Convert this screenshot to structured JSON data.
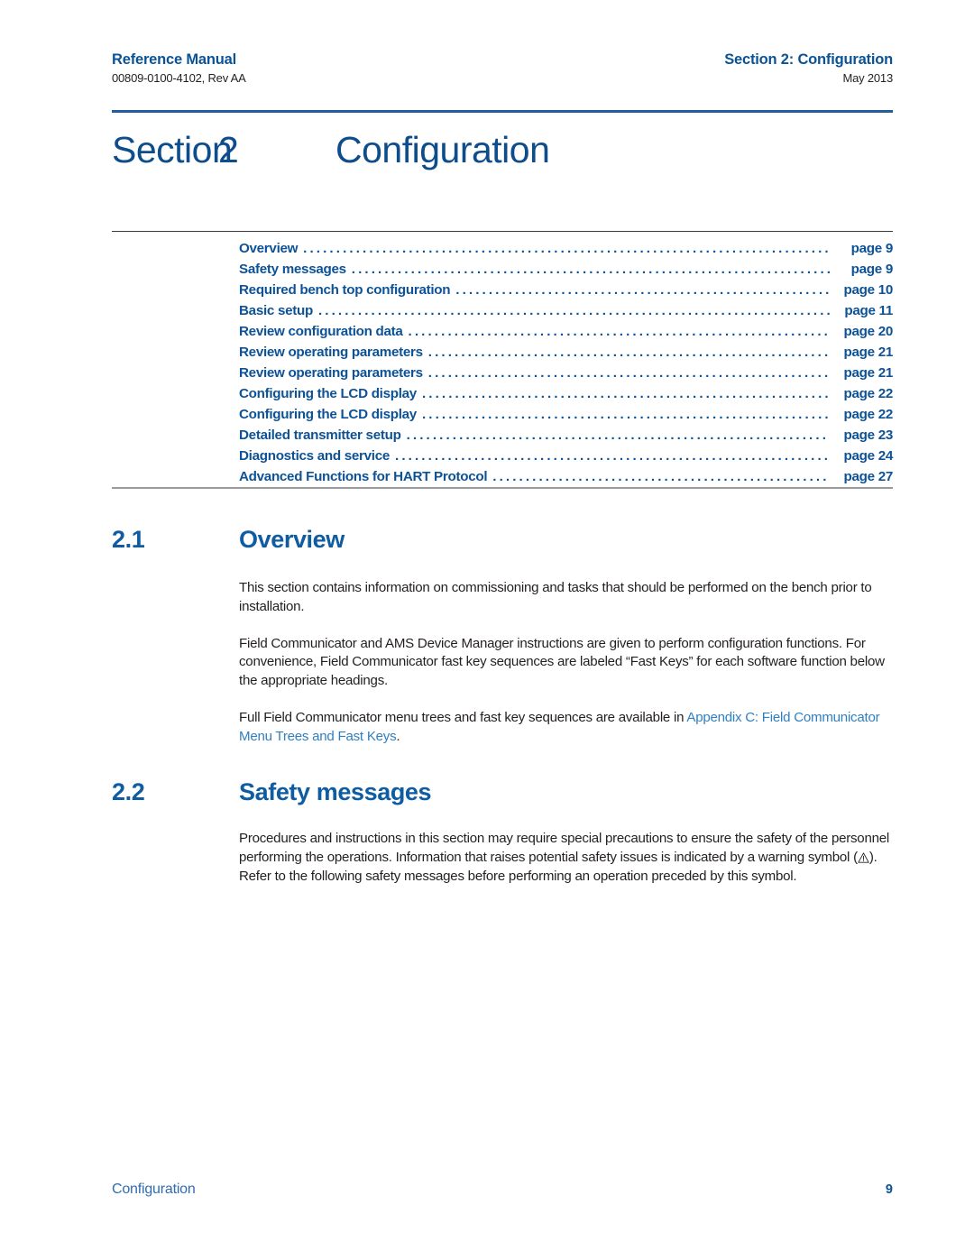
{
  "header": {
    "left_title": "Reference Manual",
    "left_subtitle": "00809-0100-4102, Rev AA",
    "right_title": "Section 2: Configuration",
    "right_subtitle": "May 2013"
  },
  "chapter": {
    "word": "Section",
    "number": "2",
    "name": "Configuration"
  },
  "toc": {
    "entries": [
      {
        "label": "Overview",
        "page": "page 9"
      },
      {
        "label": "Safety messages",
        "page": "page 9"
      },
      {
        "label": "Required bench top configuration",
        "page": "page 10"
      },
      {
        "label": "Basic setup",
        "page": "page 11"
      },
      {
        "label": "Review configuration data",
        "page": "page 20"
      },
      {
        "label": "Review operating parameters",
        "page": "page 21"
      },
      {
        "label": "Review operating parameters",
        "page": "page 21"
      },
      {
        "label": "Configuring the LCD display",
        "page": "page 22"
      },
      {
        "label": "Configuring the LCD display",
        "page": "page 22"
      },
      {
        "label": "Detailed transmitter setup",
        "page": "page 23"
      },
      {
        "label": "Diagnostics and service",
        "page": "page 24"
      },
      {
        "label": "Advanced Functions for HART Protocol",
        "page": "page 27"
      }
    ]
  },
  "section_21": {
    "number": "2.1",
    "title": "Overview",
    "paragraph_1": "This section contains information on commissioning and tasks that should be performed on the bench prior to installation.",
    "paragraph_2": "Field Communicator and AMS Device Manager instructions are given to perform configuration functions. For convenience, Field Communicator fast key sequences are labeled “Fast Keys” for each software function below the appropriate headings.",
    "paragraph_3_pre": "Full Field Communicator menu trees and fast key sequences are available in ",
    "paragraph_3_xref": "Appendix C: Field Communicator Menu Trees and Fast Keys",
    "paragraph_3_post": "."
  },
  "section_22": {
    "number": "2.2",
    "title": "Safety messages",
    "paragraph_1_pre": "Procedures and instructions in this section may require special precautions to ensure the safety of the personnel performing the operations. Information that raises potential safety issues is indicated by a warning symbol (",
    "warning_symbol": "warning-triangle",
    "paragraph_1_post": "). Refer to the following safety messages before performing an operation preceded by this symbol."
  },
  "footer": {
    "left": "Configuration",
    "right": "9"
  },
  "colors": {
    "heading_blue": "#0f5ca3",
    "chapter_blue": "#0d4d8c",
    "toc_blue": "#0d5296",
    "xref_blue": "#2f7fc1",
    "rule_blue": "#1f5fa0",
    "body_black": "#231f20"
  }
}
